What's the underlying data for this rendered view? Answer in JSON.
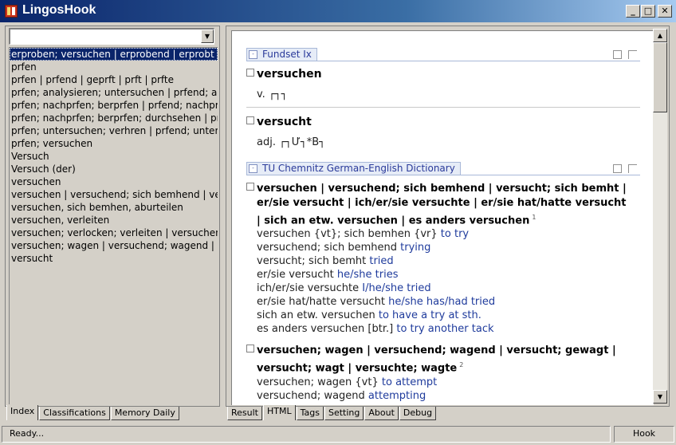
{
  "window": {
    "title": "LingosHook"
  },
  "left": {
    "combo_value": "",
    "items": [
      "erproben; versuchen | erprobend | erprobt | erprobte",
      "prfen",
      "prfen | prfend | geprft | prft | prfte",
      "prfen; analysieren; untersuchen | prfend; analysierend",
      "prfen; nachprfen; berprfen | prfend; nachprfend",
      "prfen; nachprfen; berprfen; durchsehen | prfend",
      "prfen; untersuchen; verhren | prfend; untersuchend",
      "prfen; versuchen",
      "Versuch",
      "Versuch (der)",
      "versuchen",
      "versuchen | versuchend; sich bemhend | versucht",
      "versuchen, sich bemhen, aburteilen",
      "versuchen, verleiten",
      "versuchen; verlocken; verleiten | versuchend",
      "versuchen; wagen | versuchend; wagend | versucht",
      "versucht"
    ],
    "tabs": [
      "Index",
      "Classifications",
      "Memory Daily"
    ]
  },
  "right": {
    "tabs": [
      "Result",
      "HTML",
      "Tags",
      "Setting",
      "About",
      "Debug"
    ],
    "fundset": {
      "name": "Fundset Ix",
      "entries": [
        {
          "word": "versuchen",
          "pos": "v. ┌┐┐"
        },
        {
          "word": "versucht",
          "pos": "adj. ┌┐Ư┐*B┐"
        }
      ]
    },
    "tu": {
      "name": "TU Chemnitz German-English Dictionary",
      "entry1": {
        "headword": "versuchen | versuchend; sich bemhend | versucht; sich bemht | er/sie versucht | ich/er/sie versuchte | er/sie hat/hatte versucht | sich an etw. versuchen | es anders versuchen",
        "sup": "1",
        "lines": [
          {
            "de": "versuchen {vt}; sich bemhen {vr}",
            "en": "to try"
          },
          {
            "de": "versuchend; sich bemhend",
            "en": "trying"
          },
          {
            "de": "versucht; sich bemht",
            "en": "tried"
          },
          {
            "de": "er/sie versucht",
            "en": "he/she tries"
          },
          {
            "de": "ich/er/sie versuchte",
            "en": "I/he/she tried"
          },
          {
            "de": "er/sie hat/hatte versucht",
            "en": "he/she has/had tried"
          },
          {
            "de": "sich an etw. versuchen",
            "en": "to have a try at sth."
          },
          {
            "de": "es anders versuchen [btr.]",
            "en": "to try another tack"
          }
        ]
      },
      "entry2": {
        "headword": "versuchen; wagen | versuchend; wagend | versucht; gewagt | versucht; wagt | versuchte; wagte",
        "sup": "2",
        "lines": [
          {
            "de": "versuchen; wagen {vt}",
            "en": "to attempt"
          },
          {
            "de": "versuchend; wagend",
            "en": "attempting"
          }
        ]
      }
    }
  },
  "status": {
    "left": "Ready...",
    "right": "Hook"
  }
}
